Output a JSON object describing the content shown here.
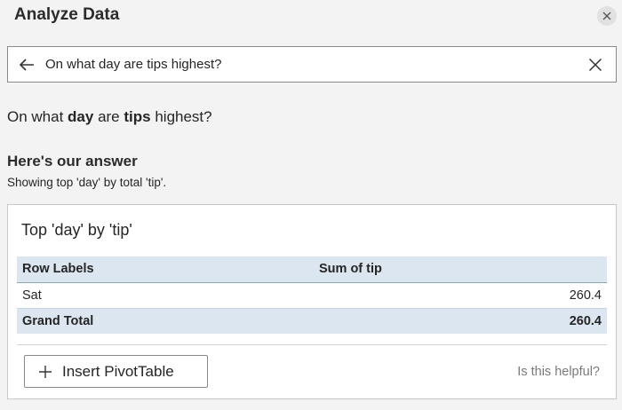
{
  "pane": {
    "title": "Analyze Data",
    "close_icon": "close-icon"
  },
  "search": {
    "back_icon": "back-arrow-icon",
    "query": "On what day are tips highest?",
    "clear_icon": "close-icon"
  },
  "question": {
    "prefix": "On what ",
    "field_1": "day",
    "middle": " are ",
    "field_2": "tips",
    "suffix": " highest?"
  },
  "answer": {
    "heading": "Here's our answer",
    "subheading": "Showing top 'day' by total 'tip'."
  },
  "card": {
    "title": "Top 'day' by 'tip'",
    "table": {
      "columns": [
        "Row Labels",
        "Sum of tip"
      ],
      "rows": [
        {
          "label": "Sat",
          "value": "260.4"
        }
      ],
      "total": {
        "label": "Grand Total",
        "value": "260.4"
      }
    },
    "insert_button": {
      "icon": "plus-icon",
      "label": "Insert PivotTable"
    },
    "feedback_prompt": "Is this helpful?"
  }
}
